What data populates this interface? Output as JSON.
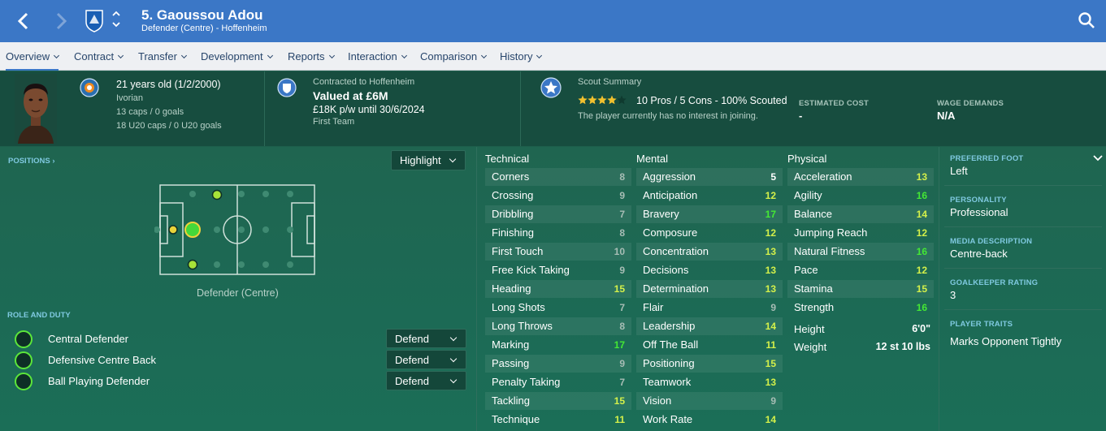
{
  "header": {
    "player_title": "5. Gaoussou Adou",
    "subtitle": "Defender (Centre) - Hoffenheim"
  },
  "tabs": [
    {
      "label": "Overview"
    },
    {
      "label": "Contract"
    },
    {
      "label": "Transfer"
    },
    {
      "label": "Development"
    },
    {
      "label": "Reports"
    },
    {
      "label": "Interaction"
    },
    {
      "label": "Comparison"
    },
    {
      "label": "History"
    }
  ],
  "info": {
    "age": "21 years old (1/2/2000)",
    "nationality": "Ivorian",
    "caps": "13 caps / 0 goals",
    "u20_caps": "18 U20 caps / 0 U20 goals",
    "contracted": "Contracted to Hoffenheim",
    "value": "Valued at £6M",
    "wage": "£18K p/w until 30/6/2024",
    "squad": "First Team",
    "scout_label": "Scout Summary",
    "scout_stars": 4,
    "scout_pros": "10 Pros / 5 Cons - 100% Scouted",
    "scout_note": "The player currently has no interest in joining.",
    "est_cost_label": "ESTIMATED COST",
    "est_cost_value": "-",
    "wage_demands_label": "WAGE DEMANDS",
    "wage_demands_value": "N/A"
  },
  "positions": {
    "label": "POSITIONS",
    "highlight_label": "Highlight",
    "position_name": "Defender (Centre)"
  },
  "roles": {
    "label": "ROLE AND DUTY",
    "items": [
      {
        "name": "Central Defender",
        "duty": "Defend"
      },
      {
        "name": "Defensive Centre Back",
        "duty": "Defend"
      },
      {
        "name": "Ball Playing Defender",
        "duty": "Defend"
      }
    ]
  },
  "attributes": {
    "technical_label": "Technical",
    "mental_label": "Mental",
    "physical_label": "Physical",
    "technical": [
      {
        "name": "Corners",
        "value": "8"
      },
      {
        "name": "Crossing",
        "value": "9"
      },
      {
        "name": "Dribbling",
        "value": "7"
      },
      {
        "name": "Finishing",
        "value": "8"
      },
      {
        "name": "First Touch",
        "value": "10"
      },
      {
        "name": "Free Kick Taking",
        "value": "9"
      },
      {
        "name": "Heading",
        "value": "15"
      },
      {
        "name": "Long Shots",
        "value": "7"
      },
      {
        "name": "Long Throws",
        "value": "8"
      },
      {
        "name": "Marking",
        "value": "17"
      },
      {
        "name": "Passing",
        "value": "9"
      },
      {
        "name": "Penalty Taking",
        "value": "7"
      },
      {
        "name": "Tackling",
        "value": "15"
      },
      {
        "name": "Technique",
        "value": "11"
      }
    ],
    "mental": [
      {
        "name": "Aggression",
        "value": "5"
      },
      {
        "name": "Anticipation",
        "value": "12"
      },
      {
        "name": "Bravery",
        "value": "17"
      },
      {
        "name": "Composure",
        "value": "12"
      },
      {
        "name": "Concentration",
        "value": "13"
      },
      {
        "name": "Decisions",
        "value": "13"
      },
      {
        "name": "Determination",
        "value": "13"
      },
      {
        "name": "Flair",
        "value": "9"
      },
      {
        "name": "Leadership",
        "value": "14"
      },
      {
        "name": "Off The Ball",
        "value": "11"
      },
      {
        "name": "Positioning",
        "value": "15"
      },
      {
        "name": "Teamwork",
        "value": "13"
      },
      {
        "name": "Vision",
        "value": "9"
      },
      {
        "name": "Work Rate",
        "value": "14"
      }
    ],
    "physical": [
      {
        "name": "Acceleration",
        "value": "13"
      },
      {
        "name": "Agility",
        "value": "16"
      },
      {
        "name": "Balance",
        "value": "14"
      },
      {
        "name": "Jumping Reach",
        "value": "12"
      },
      {
        "name": "Natural Fitness",
        "value": "16"
      },
      {
        "name": "Pace",
        "value": "12"
      },
      {
        "name": "Stamina",
        "value": "15"
      },
      {
        "name": "Strength",
        "value": "16"
      }
    ],
    "height_label": "Height",
    "height_value": "6'0\"",
    "weight_label": "Weight",
    "weight_value": "12 st 10 lbs"
  },
  "side": {
    "preferred_foot_label": "PREFERRED FOOT",
    "preferred_foot": "Left",
    "personality_label": "PERSONALITY",
    "personality": "Professional",
    "media_label": "MEDIA DESCRIPTION",
    "media": "Centre-back",
    "gk_label": "GOALKEEPER RATING",
    "gk": "3",
    "traits_label": "PLAYER TRAITS",
    "traits": "Marks Opponent Tightly"
  },
  "colors": {
    "header_blue": "#3b77c6",
    "panel_green": "#1d5f4c",
    "attr_low": "#a7bdb5",
    "attr_mid": "#d4f04a",
    "attr_high": "#44e834",
    "attr_vlow": "#ffffff",
    "accent_cyan": "#7fc9e0"
  }
}
